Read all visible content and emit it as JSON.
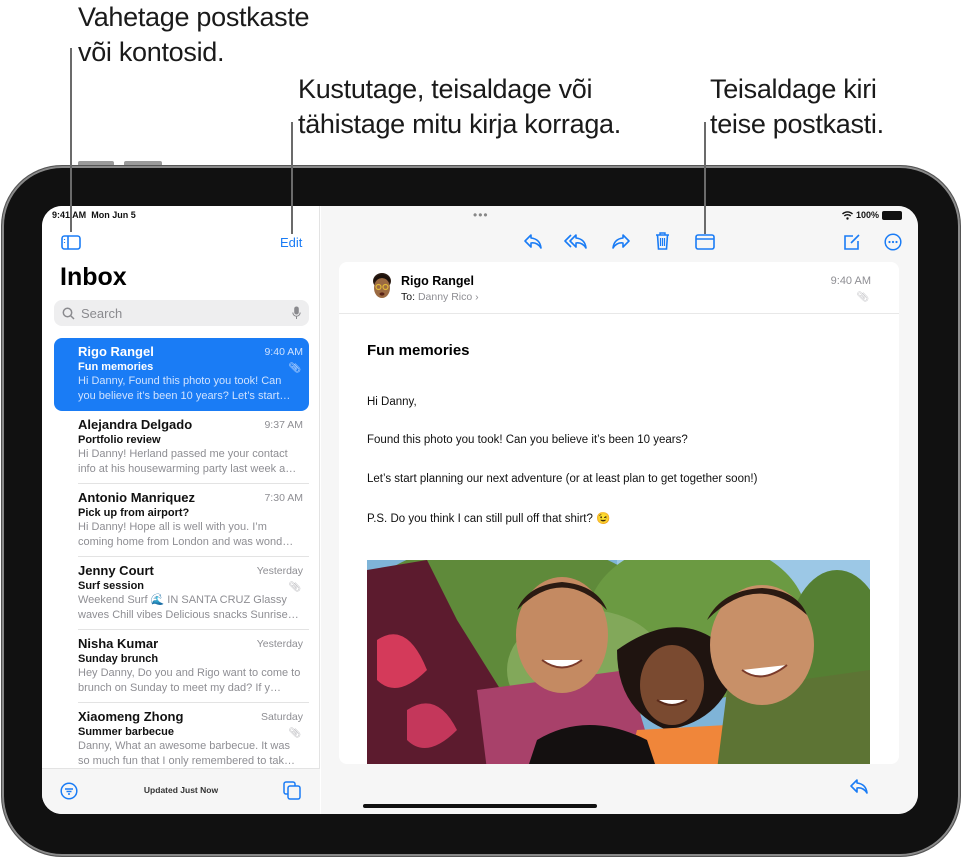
{
  "callouts": {
    "mailboxes": [
      "Vahetage postkaste",
      "või kontosid."
    ],
    "edit": [
      "Kustutage, teisaldage või",
      "tähistage mitu kirja korraga."
    ],
    "move": [
      "Teisaldage kiri",
      "teise postkasti."
    ]
  },
  "status_bar": {
    "time": "9:41 AM",
    "date": "Mon Jun 5",
    "multitask": "•••",
    "battery": "100%"
  },
  "sidebar": {
    "edit_label": "Edit",
    "title": "Inbox",
    "search_placeholder": "Search",
    "footer_status": "Updated Just Now",
    "mails": [
      {
        "from": "Rigo Rangel",
        "time": "9:40 AM",
        "subject": "Fun memories",
        "preview": "Hi Danny, Found this photo you took! Can you believe it’s been 10 years? Let’s start…",
        "attachment": true,
        "selected": true
      },
      {
        "from": "Alejandra Delgado",
        "time": "9:37 AM",
        "subject": "Portfolio review",
        "preview": "Hi Danny! Herland passed me your contact info at his housewarming party last week a…",
        "attachment": false,
        "selected": false
      },
      {
        "from": "Antonio Manriquez",
        "time": "7:30 AM",
        "subject": "Pick up from airport?",
        "preview": "Hi Danny! Hope all is well with you. I’m coming home from London and was wond…",
        "attachment": false,
        "selected": false
      },
      {
        "from": "Jenny Court",
        "time": "Yesterday",
        "subject": "Surf session",
        "preview": "Weekend Surf 🌊 IN SANTA CRUZ Glassy waves Chill vibes Delicious snacks Sunrise…",
        "attachment": true,
        "selected": false
      },
      {
        "from": "Nisha Kumar",
        "time": "Yesterday",
        "subject": "Sunday brunch",
        "preview": "Hey Danny, Do you and Rigo want to come to brunch on Sunday to meet my dad? If y…",
        "attachment": false,
        "selected": false
      },
      {
        "from": "Xiaomeng Zhong",
        "time": "Saturday",
        "subject": "Summer barbecue",
        "preview": "Danny, What an awesome barbecue. It was so much fun that I only remembered to tak…",
        "attachment": true,
        "selected": false
      }
    ]
  },
  "message": {
    "sender": "Rigo Rangel",
    "to_label": "To:",
    "to_name": "Danny Rico",
    "time": "9:40 AM",
    "subject": "Fun memories",
    "body": [
      "Hi Danny,",
      "Found this photo you took! Can you believe it’s been 10 years?",
      "Let’s start planning our next adventure (or at least plan to get together soon!)",
      "P.S. Do you think I can still pull off that shirt? 😉"
    ],
    "photo_alt": "Selfie of four smiling friends outdoors under trees"
  },
  "colors": {
    "accent": "#1a7cf5",
    "secondary_text": "#8e8e93"
  }
}
